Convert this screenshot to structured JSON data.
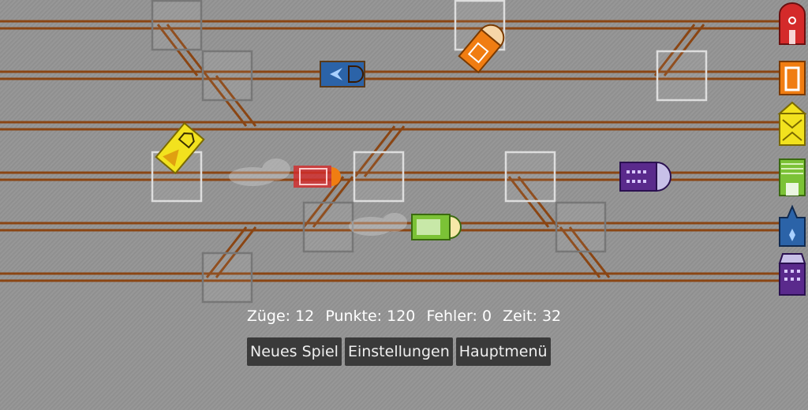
{
  "status": {
    "trains_label": "Züge: 12",
    "points_label": "Punkte: 120",
    "errors_label": "Fehler: 0",
    "time_label": "Zeit: 32"
  },
  "menu": {
    "new_game": "Neues Spiel",
    "settings": "Einstellungen",
    "main_menu": "Hauptmenü"
  },
  "colors": {
    "track": "#8a4513",
    "stations": [
      "#d42a2a",
      "#f07d12",
      "#f2e21e",
      "#7bc236",
      "#2b63a8",
      "#5a2a8c"
    ]
  },
  "stations": [
    "red-house",
    "orange-house",
    "yellow-house",
    "green-house",
    "blue-house",
    "purple-house"
  ],
  "trains": [
    {
      "color": "blue"
    },
    {
      "color": "orange"
    },
    {
      "color": "yellow"
    },
    {
      "color": "red"
    },
    {
      "color": "purple"
    },
    {
      "color": "green"
    }
  ]
}
